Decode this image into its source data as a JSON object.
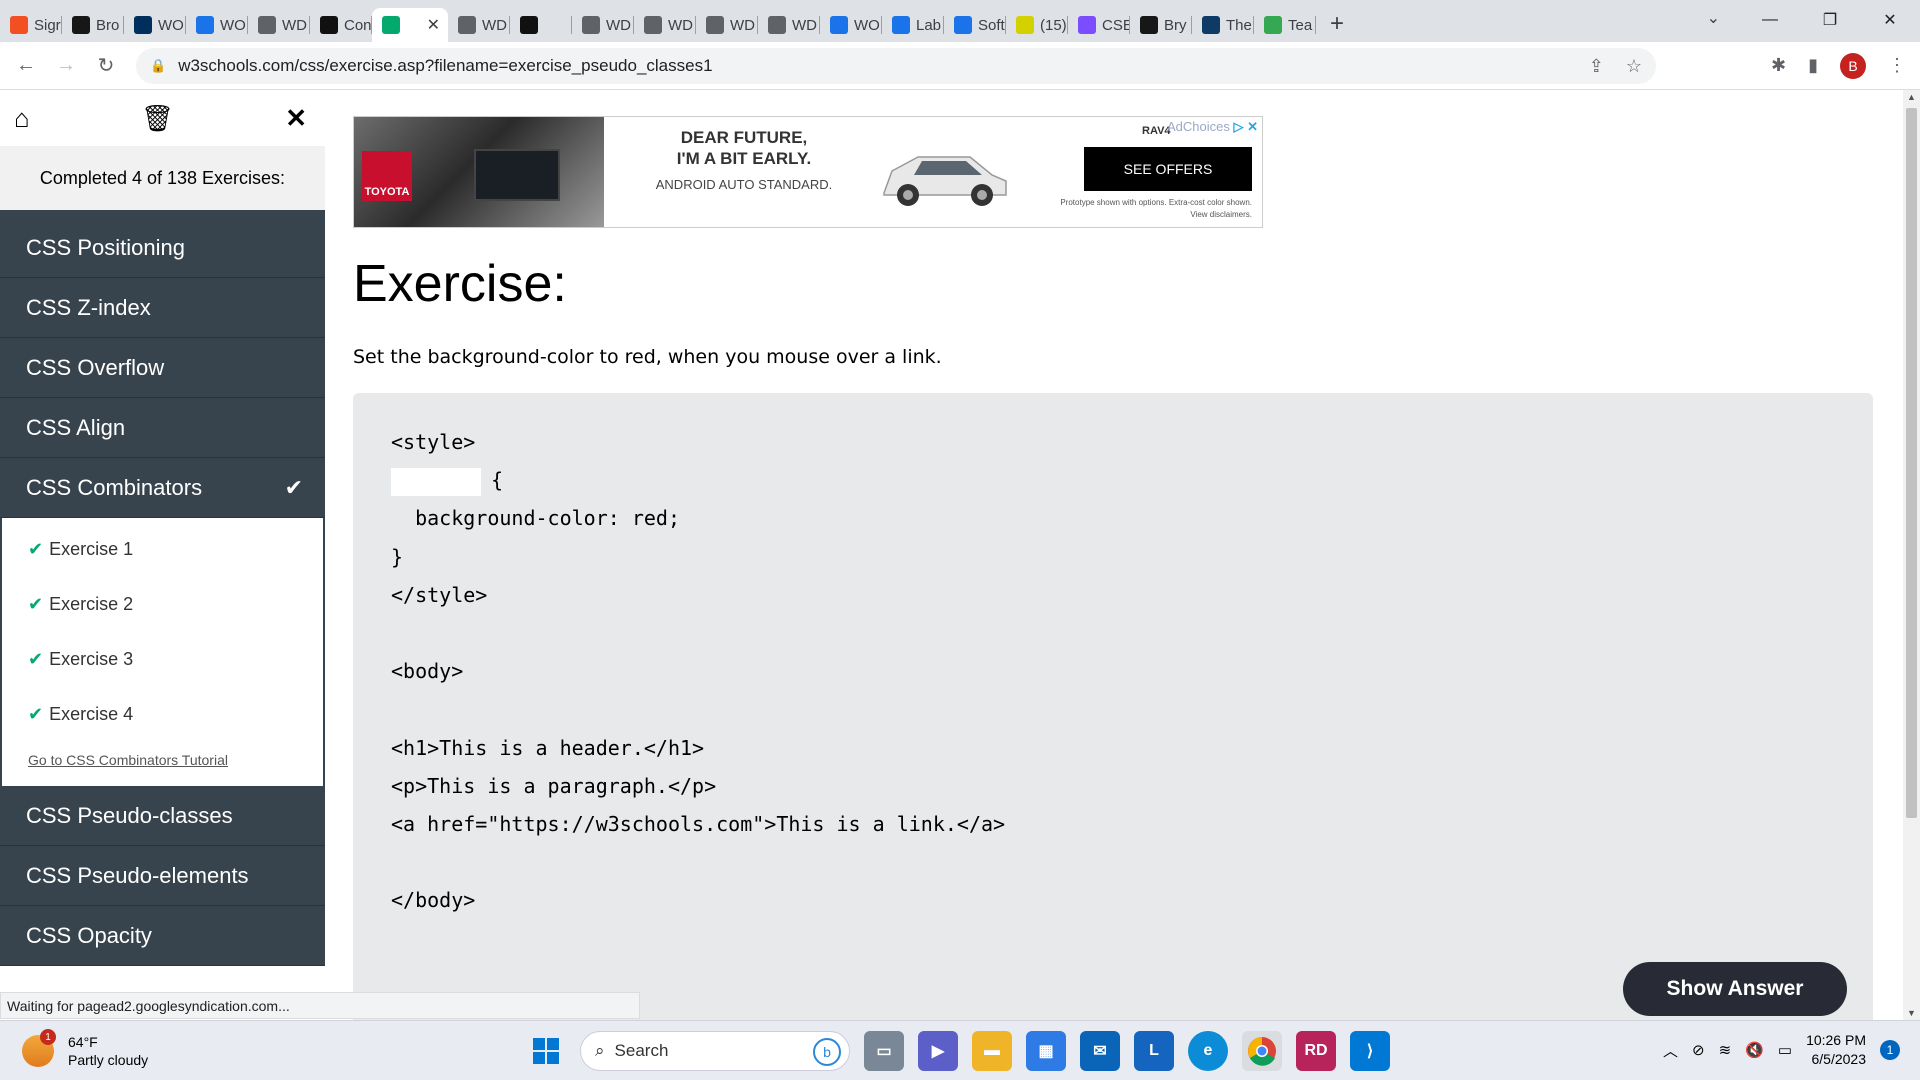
{
  "browser": {
    "tabs": [
      {
        "label": "Sigr",
        "favicon": "microsoft-icon",
        "color": "#f25022"
      },
      {
        "label": "Bro",
        "favicon": "github-icon",
        "color": "#181717"
      },
      {
        "label": "WO",
        "favicon": "byu-icon",
        "color": "#002e5d"
      },
      {
        "label": "WO",
        "favicon": "chart-icon",
        "color": "#1a73e8"
      },
      {
        "label": "WD",
        "favicon": "globe-icon",
        "color": "#5f6368"
      },
      {
        "label": "Con",
        "favicon": "m-icon",
        "color": "#111111"
      },
      {
        "label": "",
        "favicon": "w3schools-icon",
        "color": "#04aa6d",
        "active": true
      },
      {
        "label": "WD",
        "favicon": "globe-icon",
        "color": "#5f6368"
      },
      {
        "label": "",
        "favicon": "openai-icon",
        "color": "#111111"
      },
      {
        "label": "WD",
        "favicon": "globe-icon",
        "color": "#5f6368"
      },
      {
        "label": "WD",
        "favicon": "globe-icon",
        "color": "#5f6368"
      },
      {
        "label": "WD",
        "favicon": "globe-icon",
        "color": "#5f6368"
      },
      {
        "label": "WD",
        "favicon": "globe-icon",
        "color": "#5f6368"
      },
      {
        "label": "WO",
        "favicon": "chart-icon",
        "color": "#1a73e8"
      },
      {
        "label": "Lab",
        "favicon": "circle-icon",
        "color": "#1a73e8"
      },
      {
        "label": "Soft",
        "favicon": "circle-icon",
        "color": "#1a73e8"
      },
      {
        "label": "(15)",
        "favicon": "h-icon",
        "color": "#d4d100"
      },
      {
        "label": "CSE",
        "favicon": "chart-icon",
        "color": "#7c4dff"
      },
      {
        "label": "Bry",
        "favicon": "github-icon",
        "color": "#181717"
      },
      {
        "label": "The",
        "favicon": "book-icon",
        "color": "#0d3b66"
      },
      {
        "label": "Tea",
        "favicon": "plus-icon",
        "color": "#34a853"
      }
    ],
    "url": "w3schools.com/css/exercise.asp?filename=exercise_pseudo_classes1",
    "profile_initial": "B",
    "status_text": "Waiting for pagead2.googlesyndication.com..."
  },
  "sidebar": {
    "completed_text": "Completed 4 of 138 Exercises:",
    "items_top": [
      "CSS Positioning",
      "CSS Z-index",
      "CSS Overflow",
      "CSS Align",
      "CSS Combinators"
    ],
    "exercises": [
      "Exercise 1",
      "Exercise 2",
      "Exercise 3",
      "Exercise 4"
    ],
    "tutorial_link": "Go to CSS Combinators Tutorial",
    "items_bottom": [
      "CSS Pseudo-classes",
      "CSS Pseudo-elements",
      "CSS Opacity"
    ]
  },
  "ad": {
    "brand": "TOYOTA",
    "headline_1": "DEAR FUTURE,",
    "headline_2": "I'M A BIT EARLY.",
    "subline": "ANDROID AUTO STANDARD.",
    "model": "RAV4",
    "button": "SEE OFFERS",
    "adchoices": "AdChoices",
    "disclaimer_1": "Prototype shown with options. Extra-cost color shown.",
    "disclaimer_2": "View disclaimers."
  },
  "exercise": {
    "title": "Exercise:",
    "instruction": "Set the background-color to red, when you mouse over a link.",
    "code": {
      "l1": "<style>",
      "l2": "{",
      "l3": "  background-color: red;",
      "l4": "}",
      "l5": "</style>",
      "l6": "<body>",
      "l7": "<h1>This is a header.</h1>",
      "l8": "<p>This is a paragraph.</p>",
      "l9": "<a href=\"https://w3schools.com\">This is a link.</a>",
      "l10": "</body>"
    },
    "show_answer": "Show Answer"
  },
  "taskbar": {
    "temperature": "64°F",
    "weather": "Partly cloudy",
    "weather_badge": "1",
    "search_placeholder": "Search",
    "time": "10:26 PM",
    "date": "6/5/2023",
    "notifications": "1"
  },
  "colors": {
    "sidebar_bg": "#38444d",
    "accent_green": "#04aa6d",
    "code_bg": "#e7e9eb",
    "button_dark": "#282a35"
  }
}
